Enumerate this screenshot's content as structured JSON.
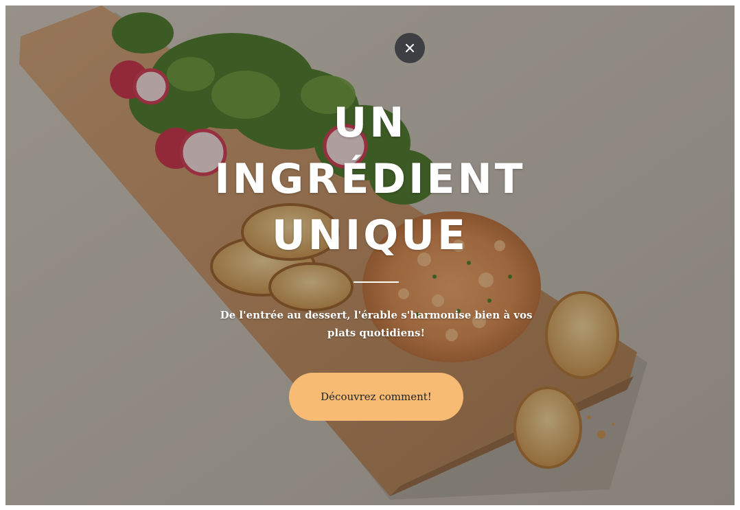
{
  "modal": {
    "headline": [
      "UN",
      "INGRÉDIENT",
      "UNIQUE"
    ],
    "subtitle": "De l'entrée au dessert, l'érable s'harmonise bien à vos plats quotidiens!",
    "cta_label": "Découvrez comment!",
    "close_icon": "close-icon"
  },
  "colors": {
    "cta_background": "#f8bb74",
    "close_background": "#3d3f43",
    "text": "#ffffff"
  }
}
